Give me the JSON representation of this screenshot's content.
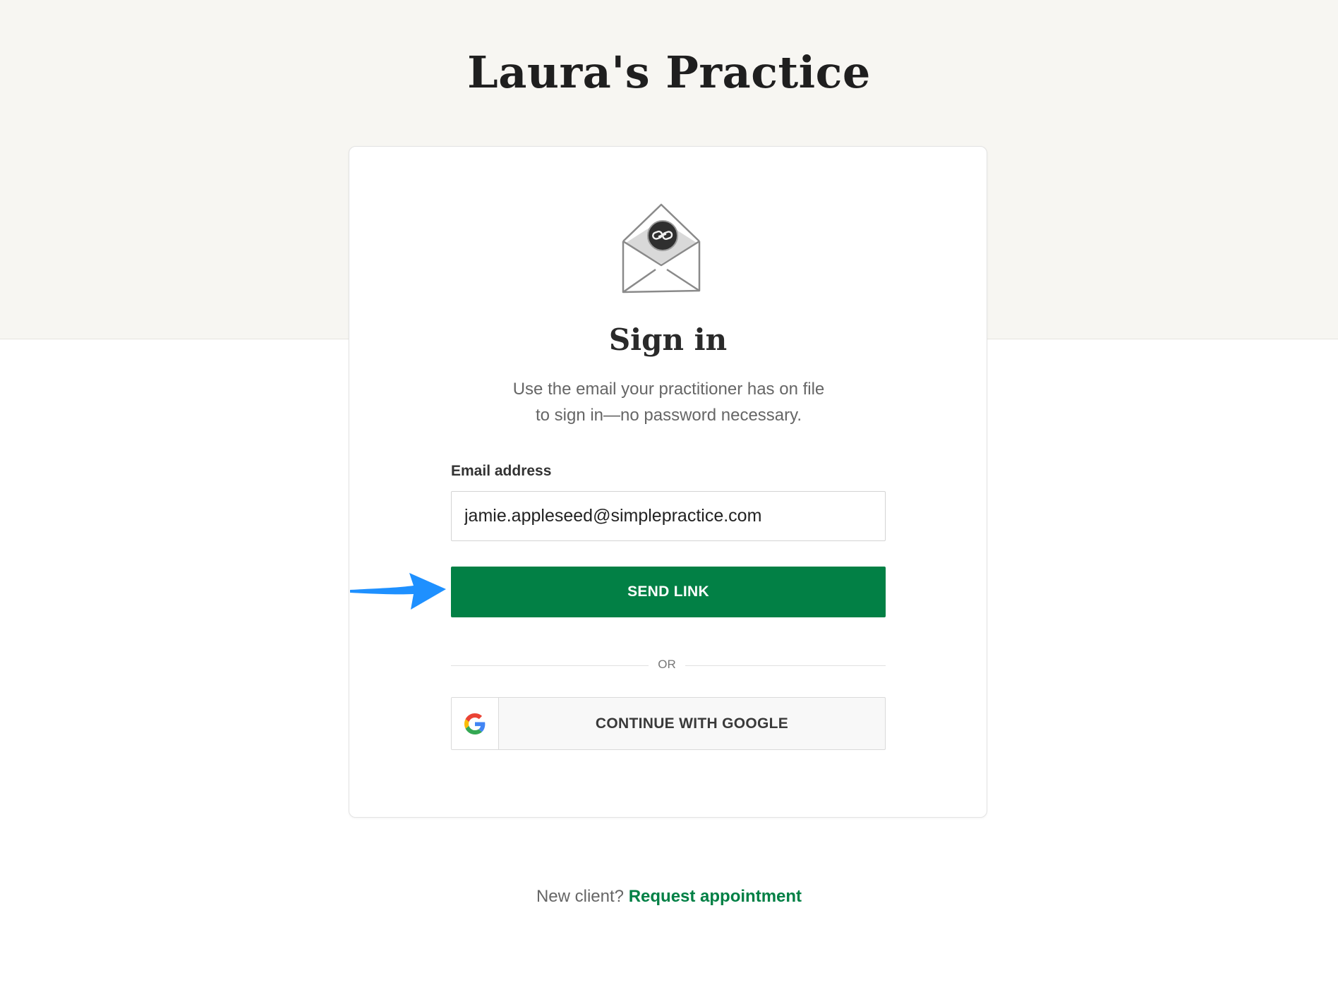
{
  "header": {
    "practice_name": "Laura's Practice"
  },
  "card": {
    "illustration_icon": "envelope-link-icon",
    "title": "Sign in",
    "subtitle_line1": "Use the email your practitioner has on file",
    "subtitle_line2": "to sign in—no password necessary.",
    "email_label": "Email address",
    "email_value": "jamie.appleseed@simplepractice.com",
    "send_button_label": "SEND LINK",
    "divider_text": "OR",
    "google_button_label": "CONTINUE WITH GOOGLE",
    "google_icon": "google-g-icon"
  },
  "footer": {
    "prompt": "New client?",
    "link_label": "Request appointment"
  },
  "colors": {
    "primary_green": "#028045",
    "top_band": "#f7f6f2",
    "annotation_arrow": "#1e90ff"
  }
}
